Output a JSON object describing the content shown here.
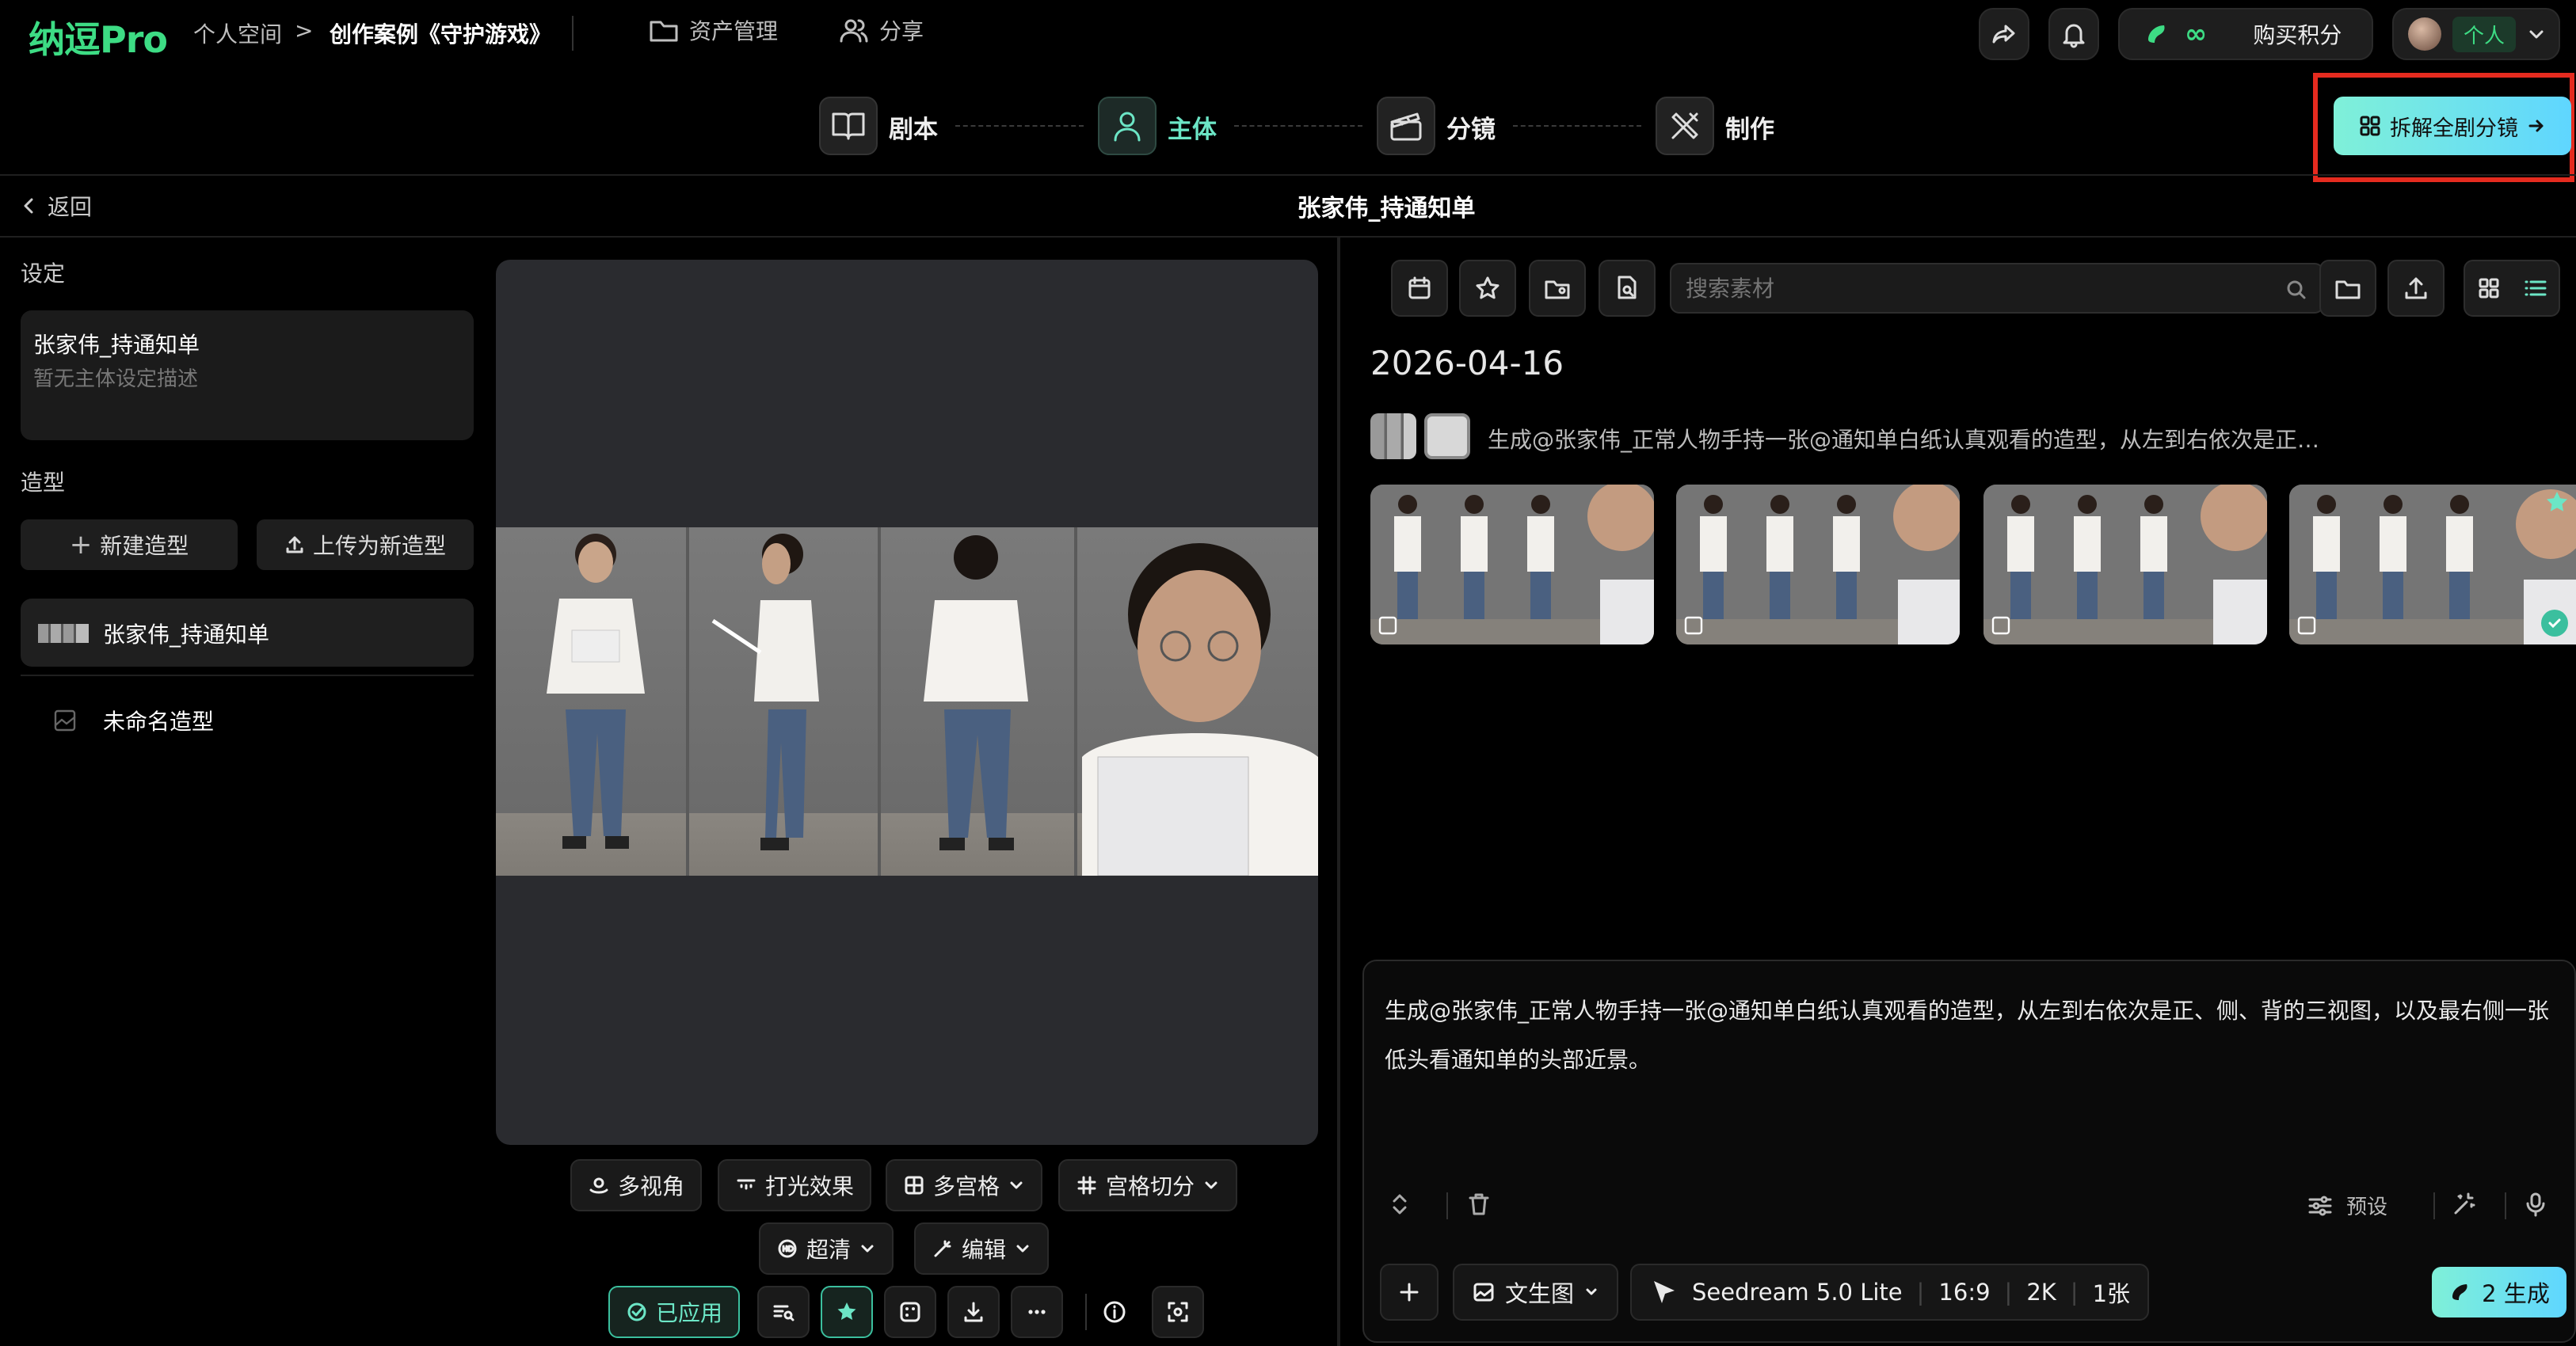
{
  "app": {
    "logo": "纳逗Pro"
  },
  "breadcrumb": {
    "space": "个人空间",
    "sep": ">",
    "project": "创作案例《守护游戏》"
  },
  "nav": {
    "assets": "资产管理",
    "share": "分享"
  },
  "header": {
    "credits_value": "∞",
    "buy_label": "购买积分",
    "account_label": "个人"
  },
  "steps": [
    {
      "label": "剧本",
      "icon": "book-icon"
    },
    {
      "label": "主体",
      "icon": "user-icon"
    },
    {
      "label": "分镜",
      "icon": "clapper-icon"
    },
    {
      "label": "制作",
      "icon": "tools-icon"
    }
  ],
  "split_button": "拆解全剧分镜",
  "subheader": {
    "back": "返回",
    "title": "张家伟_持通知单"
  },
  "left": {
    "settings_heading": "设定",
    "subject_name": "张家伟_持通知单",
    "subject_desc": "暂无主体设定描述",
    "styles_heading": "造型",
    "new_style": "新建造型",
    "upload_style": "上传为新造型",
    "styles": [
      {
        "name": "张家伟_持通知单",
        "selected": true
      },
      {
        "name": "未命名造型",
        "selected": false
      }
    ]
  },
  "center_tools": {
    "row1": [
      "多视角",
      "打光效果",
      "多宫格",
      "宫格切分"
    ],
    "row2": [
      "超清",
      "编辑"
    ],
    "applied": "已应用"
  },
  "right": {
    "search_placeholder": "搜索素材",
    "date": "2026-04-16",
    "gen_caption": "生成@张家伟_正常人物手持一张@通知单白纸认真观看的造型，从左到右依次是正…",
    "prompt_text": "生成@张家伟_正常人物手持一张@通知单白纸认真观看的造型，从左到右依次是正、侧、背的三视图，以及最右侧一张低头看通知单的头部近景。",
    "preset_label": "预设",
    "mode_label": "文生图",
    "model_label": "Seedream 5.0 Lite",
    "ratio": "16:9",
    "resolution": "2K",
    "count": "1张",
    "generate_label": "2 生成"
  },
  "colors": {
    "accent": "#3ddc84",
    "teal": "#6ce6c6",
    "highlight": "#e52b1f"
  }
}
